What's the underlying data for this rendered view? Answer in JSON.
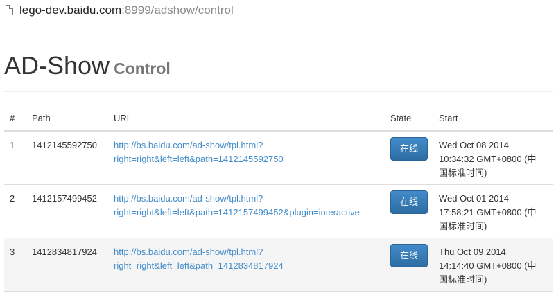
{
  "browser": {
    "url_host": "lego-dev.baidu.com",
    "url_rest": ":8999/adshow/control"
  },
  "page": {
    "title": "AD-Show",
    "subtitle": "Control"
  },
  "table": {
    "headers": {
      "num": "#",
      "path": "Path",
      "url": "URL",
      "state": "State",
      "start": "Start"
    },
    "rows": [
      {
        "num": "1",
        "path": "1412145592750",
        "url_line1": "http://bs.baidu.com/ad-show/tpl.html?",
        "url_line2": "right=right&left=left&path=1412145592750",
        "state": "在线",
        "start_line1": "Wed Oct 08 2014",
        "start_line2": "10:34:32 GMT+0800 (中",
        "start_line3": "国标准时间)"
      },
      {
        "num": "2",
        "path": "1412157499452",
        "url_line1": "http://bs.baidu.com/ad-show/tpl.html?",
        "url_line2": "right=right&left=left&path=1412157499452&plugin=interactive",
        "state": "在线",
        "start_line1": "Wed Oct 01 2014",
        "start_line2": "17:58:21 GMT+0800 (中",
        "start_line3": "国标准时间)"
      },
      {
        "num": "3",
        "path": "1412834817924",
        "url_line1": "http://bs.baidu.com/ad-show/tpl.html?",
        "url_line2": "right=right&left=left&path=1412834817924",
        "state": "在线",
        "start_line1": "Thu Oct 09 2014",
        "start_line2": "14:14:40 GMT+0800 (中",
        "start_line3": "国标准时间)"
      }
    ]
  },
  "colors": {
    "link": "#428bca",
    "button": "#428bca",
    "stripe": "#f5f5f5"
  }
}
